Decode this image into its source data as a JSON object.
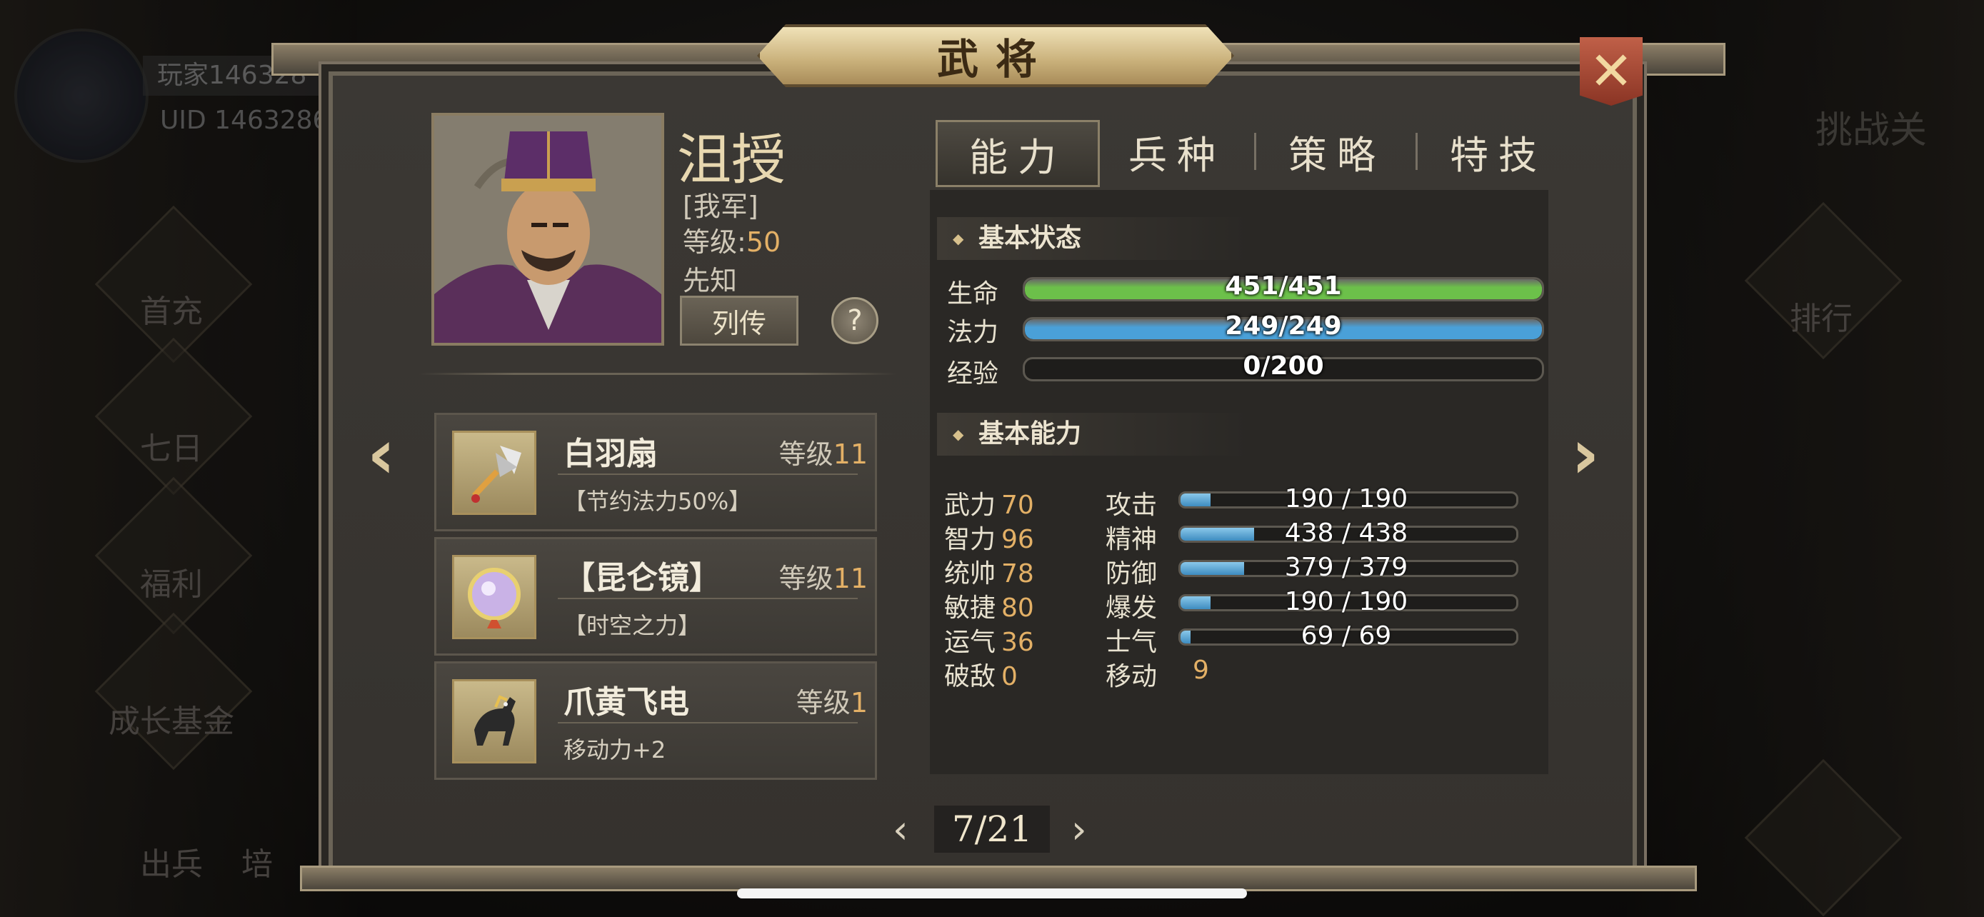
{
  "background": {
    "player_name": "玩家146328",
    "player_uid": "UID 1463286",
    "left_menu": [
      "首充",
      "七日",
      "福利",
      "成长基金",
      "出兵",
      "培"
    ],
    "right_title": "挑战关",
    "right_menu": [
      "排行"
    ]
  },
  "dialog": {
    "title": "武将",
    "close_icon": "close-x-icon"
  },
  "hero": {
    "name": "沮授",
    "faction": "[我军]",
    "level_label": "等级:",
    "level_value": "50",
    "class": "先知",
    "bio_button": "列传",
    "help_button": "?"
  },
  "equipment": [
    {
      "name": "白羽扇",
      "level_label": "等级",
      "level": "11",
      "desc": "【节约法力50%】",
      "icon": "fan-icon"
    },
    {
      "name": "【昆仑镜】",
      "level_label": "等级",
      "level": "11",
      "desc": "【时空之力】",
      "icon": "mirror-icon"
    },
    {
      "name": "爪黄飞电",
      "level_label": "等级",
      "level": "1",
      "desc": "移动力+2",
      "icon": "horse-icon"
    }
  ],
  "tabs": [
    "能力",
    "兵种",
    "策略",
    "特技"
  ],
  "active_tab": 0,
  "basic_status": {
    "header": "基本状态",
    "hp": {
      "label": "生命",
      "text": "451/451",
      "fraction": 1.0,
      "color": "#6cc04a"
    },
    "mp": {
      "label": "法力",
      "text": "249/249",
      "fraction": 1.0,
      "color": "#4aa0d8"
    },
    "exp": {
      "label": "经验",
      "text": "0/200",
      "fraction": 0.0,
      "color": "#4aa0d8"
    }
  },
  "basic_ability": {
    "header": "基本能力",
    "attrs": [
      {
        "label": "武力",
        "value": "70"
      },
      {
        "label": "智力",
        "value": "96"
      },
      {
        "label": "统帅",
        "value": "78"
      },
      {
        "label": "敏捷",
        "value": "80"
      },
      {
        "label": "运气",
        "value": "36"
      },
      {
        "label": "破敌",
        "value": "0"
      }
    ],
    "derived": [
      {
        "label": "攻击",
        "text": "190 / 190",
        "fraction": 0.09
      },
      {
        "label": "精神",
        "text": "438 / 438",
        "fraction": 0.22
      },
      {
        "label": "防御",
        "text": "379 / 379",
        "fraction": 0.19
      },
      {
        "label": "爆发",
        "text": "190 / 190",
        "fraction": 0.09
      },
      {
        "label": "士气",
        "text": "69 / 69",
        "fraction": 0.03
      }
    ],
    "move_label": "移动",
    "move_value": "9"
  },
  "pager": {
    "text": "7/21"
  },
  "colors": {
    "accent_gold": "#e3b066",
    "title_plate": "#d8c28e",
    "close_red": "#a8442e"
  }
}
